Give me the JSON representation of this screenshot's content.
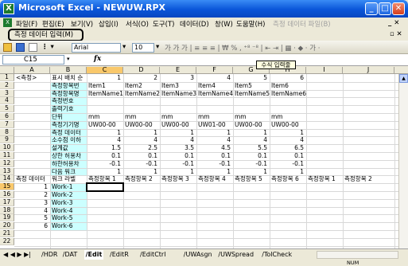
{
  "window": {
    "title": "Microsoft Excel - NEWUW.RPX",
    "app_icon": "excel-icon"
  },
  "menu": [
    "파일(F)",
    "편집(E)",
    "보기(V)",
    "삽입(I)",
    "서식(O)",
    "도구(T)",
    "데이터(D)",
    "창(W)",
    "도움말(H)",
    "측정 데이터 파일(B)"
  ],
  "menu_extra": "측정 데이터 입력(M)",
  "toolbar": {
    "font": "Arial",
    "size": "10",
    "format_buttons": "가  가  가  |  ≡  ≡  ≡  |  ₩  %  ,  ⁺⁸  ⁻⁸  |  ⇤  ⇥  |  ▦ ·  ◆ ·  가 ·"
  },
  "formula_bar": {
    "name_box": "C15",
    "fx": "fx",
    "value": ""
  },
  "tooltip": "수식 입력줄",
  "columns": [
    "A",
    "B",
    "C",
    "D",
    "E",
    "F",
    "G",
    "H",
    "I",
    "J"
  ],
  "selected_column": "C",
  "rows": [
    {
      "n": "1",
      "A": "<측정>",
      "B": "표시 배치 순",
      "C": "1",
      "D": "2",
      "E": "3",
      "F": "4",
      "G": "5",
      "H": "6",
      "I": "",
      "J": ""
    },
    {
      "n": "2",
      "A": "",
      "B": "측정항목번",
      "C": "Item1",
      "D": "Item2",
      "E": "Item3",
      "F": "Item4",
      "G": "Item5",
      "H": "Item6",
      "I": "",
      "J": ""
    },
    {
      "n": "3",
      "A": "",
      "B": "측정항목명",
      "C": "ItemName1",
      "D": "ItemName2",
      "E": "ItemName3",
      "F": "ItemName4",
      "G": "ItemName5",
      "H": "ItemName6",
      "I": "",
      "J": ""
    },
    {
      "n": "4",
      "A": "",
      "B": "측정번호",
      "C": "",
      "D": "",
      "E": "",
      "F": "",
      "G": "",
      "H": "",
      "I": "",
      "J": ""
    },
    {
      "n": "5",
      "A": "",
      "B": "출력기호",
      "C": "",
      "D": "",
      "E": "",
      "F": "",
      "G": "",
      "H": "",
      "I": "",
      "J": ""
    },
    {
      "n": "6",
      "A": "",
      "B": "단위",
      "C": "mm",
      "D": "mm",
      "E": "mm",
      "F": "mm",
      "G": "mm",
      "H": "mm",
      "I": "",
      "J": ""
    },
    {
      "n": "7",
      "A": "",
      "B": "측정기기명",
      "C": "UW00-00",
      "D": "UW00-00",
      "E": "UW00-00",
      "F": "UW01-00",
      "G": "UW00-00",
      "H": "UW00-00",
      "I": "",
      "J": ""
    },
    {
      "n": "8",
      "A": "",
      "B": "측정 데이터",
      "C": "1",
      "D": "1",
      "E": "1",
      "F": "1",
      "G": "1",
      "H": "1",
      "I": "",
      "J": ""
    },
    {
      "n": "9",
      "A": "",
      "B": "소수점 이하",
      "C": "4",
      "D": "4",
      "E": "4",
      "F": "4",
      "G": "4",
      "H": "4",
      "I": "",
      "J": ""
    },
    {
      "n": "10",
      "A": "",
      "B": "설계값",
      "C": "1.5",
      "D": "2.5",
      "E": "3.5",
      "F": "4.5",
      "G": "5.5",
      "H": "6.5",
      "I": "",
      "J": ""
    },
    {
      "n": "11",
      "A": "",
      "B": "상한 허용차",
      "C": "0.1",
      "D": "0.1",
      "E": "0.1",
      "F": "0.1",
      "G": "0.1",
      "H": "0.1",
      "I": "",
      "J": ""
    },
    {
      "n": "12",
      "A": "",
      "B": "하한허용차",
      "C": "-0.1",
      "D": "-0.1",
      "E": "-0.1",
      "F": "-0.1",
      "G": "-0.1",
      "H": "-0.1",
      "I": "",
      "J": ""
    },
    {
      "n": "13",
      "A": "",
      "B": "다음 워크",
      "C": "1",
      "D": "1",
      "E": "1",
      "F": "1",
      "G": "1",
      "H": "1",
      "I": "",
      "J": ""
    },
    {
      "n": "14",
      "A": "측정 데이터",
      "B": "워크 라벨",
      "C": "측정항목 1",
      "D": "측정항목 2",
      "E": "측정항목 3",
      "F": "측정항목 4",
      "G": "측정항목 5",
      "H": "측정항목 6",
      "I": "측정항목 1",
      "J": "측정항목 2"
    },
    {
      "n": "15",
      "A": "1",
      "B": "Work-1",
      "C": "",
      "D": "",
      "E": "",
      "F": "",
      "G": "",
      "H": "",
      "I": "",
      "J": ""
    },
    {
      "n": "16",
      "A": "2",
      "B": "Work-2",
      "C": "",
      "D": "",
      "E": "",
      "F": "",
      "G": "",
      "H": "",
      "I": "",
      "J": ""
    },
    {
      "n": "17",
      "A": "3",
      "B": "Work-3",
      "C": "",
      "D": "",
      "E": "",
      "F": "",
      "G": "",
      "H": "",
      "I": "",
      "J": ""
    },
    {
      "n": "18",
      "A": "4",
      "B": "Work-4",
      "C": "",
      "D": "",
      "E": "",
      "F": "",
      "G": "",
      "H": "",
      "I": "",
      "J": ""
    },
    {
      "n": "19",
      "A": "5",
      "B": "Work-5",
      "C": "",
      "D": "",
      "E": "",
      "F": "",
      "G": "",
      "H": "",
      "I": "",
      "J": ""
    },
    {
      "n": "20",
      "A": "6",
      "B": "Work-6",
      "C": "",
      "D": "",
      "E": "",
      "F": "",
      "G": "",
      "H": "",
      "I": "",
      "J": ""
    },
    {
      "n": "21",
      "A": "",
      "B": "",
      "C": "",
      "D": "",
      "E": "",
      "F": "",
      "G": "",
      "H": "",
      "I": "",
      "J": ""
    },
    {
      "n": "22",
      "A": "",
      "B": "",
      "C": "",
      "D": "",
      "E": "",
      "F": "",
      "G": "",
      "H": "",
      "I": "",
      "J": ""
    }
  ],
  "sheet_nav": "◀ ◀ ▶ ▶|",
  "sheets": [
    "HDR",
    "DAT",
    "Edit",
    "EditR",
    "EditCtrl",
    "UWAsgn",
    "UWSpread",
    "TolCheck"
  ],
  "active_sheet": "Edit",
  "status": {
    "right": "NUM"
  },
  "colors": {
    "highlight": "#ccffff",
    "selected_header": "#f9c86b",
    "titlebar": "#0a55d8"
  }
}
